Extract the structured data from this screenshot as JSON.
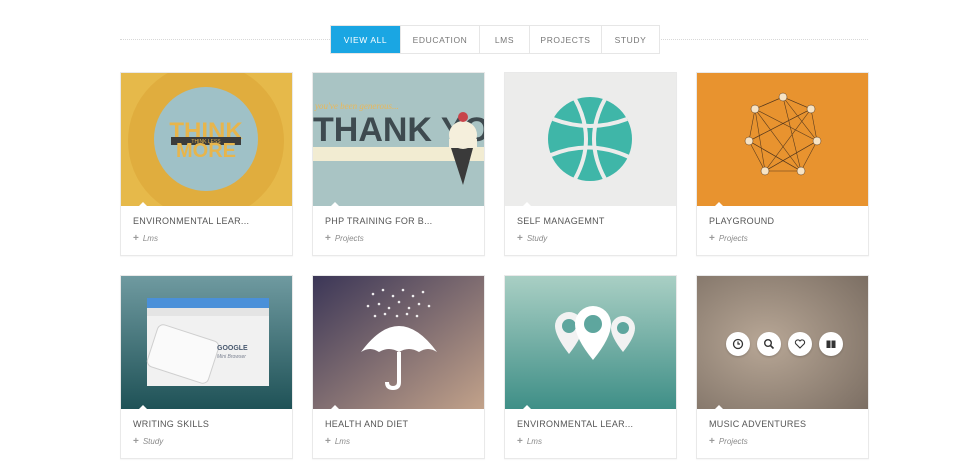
{
  "filters": [
    "VIEW ALL",
    "EDUCATION",
    "LMS",
    "PROJECTS",
    "STUDY"
  ],
  "active_filter": "VIEW ALL",
  "accent_color": "#1aa6e3",
  "thumb_text": {
    "think": "THINK",
    "more": "MORE",
    "think_banner": "THINK LESS",
    "generous": "you've been generous...",
    "thank_you": "THANK YO",
    "google": "GOOGLE",
    "mini_browser": "Mini Browser"
  },
  "cards": [
    {
      "title": "ENVIRONMENTAL LEAR...",
      "category": "Lms"
    },
    {
      "title": "PHP TRAINING FOR B...",
      "category": "Projects"
    },
    {
      "title": "SELF MANAGEMNT",
      "category": "Study"
    },
    {
      "title": "PLAYGROUND",
      "category": "Projects"
    },
    {
      "title": "WRITING SKILLS",
      "category": "Study"
    },
    {
      "title": "HEALTH AND DIET",
      "category": "Lms"
    },
    {
      "title": "ENVIRONMENTAL LEAR...",
      "category": "Lms"
    },
    {
      "title": "MUSIC ADVENTURES",
      "category": "Projects"
    }
  ],
  "hover_icons": [
    "clock-icon",
    "search-icon",
    "heart-icon",
    "book-icon"
  ]
}
